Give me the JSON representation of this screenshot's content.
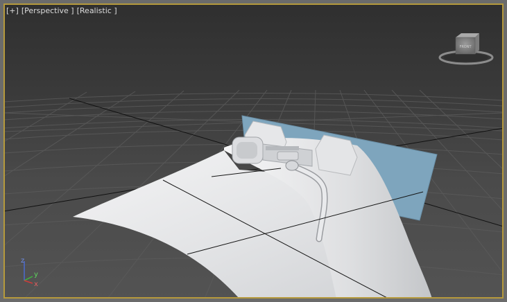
{
  "viewport": {
    "labels": {
      "menu": "[+]",
      "view": "[Perspective ]",
      "shading": "[Realistic ]"
    }
  },
  "axis_tripod": {
    "x_label": "x",
    "y_label": "y",
    "z_label": "z"
  },
  "viewcube": {
    "face_label": "FRONT"
  },
  "colors": {
    "active_border": "#b69a3c",
    "backdrop_plane": "#7ea5bd",
    "model": "#e8e9ea",
    "grid": "#5a5a5a"
  }
}
